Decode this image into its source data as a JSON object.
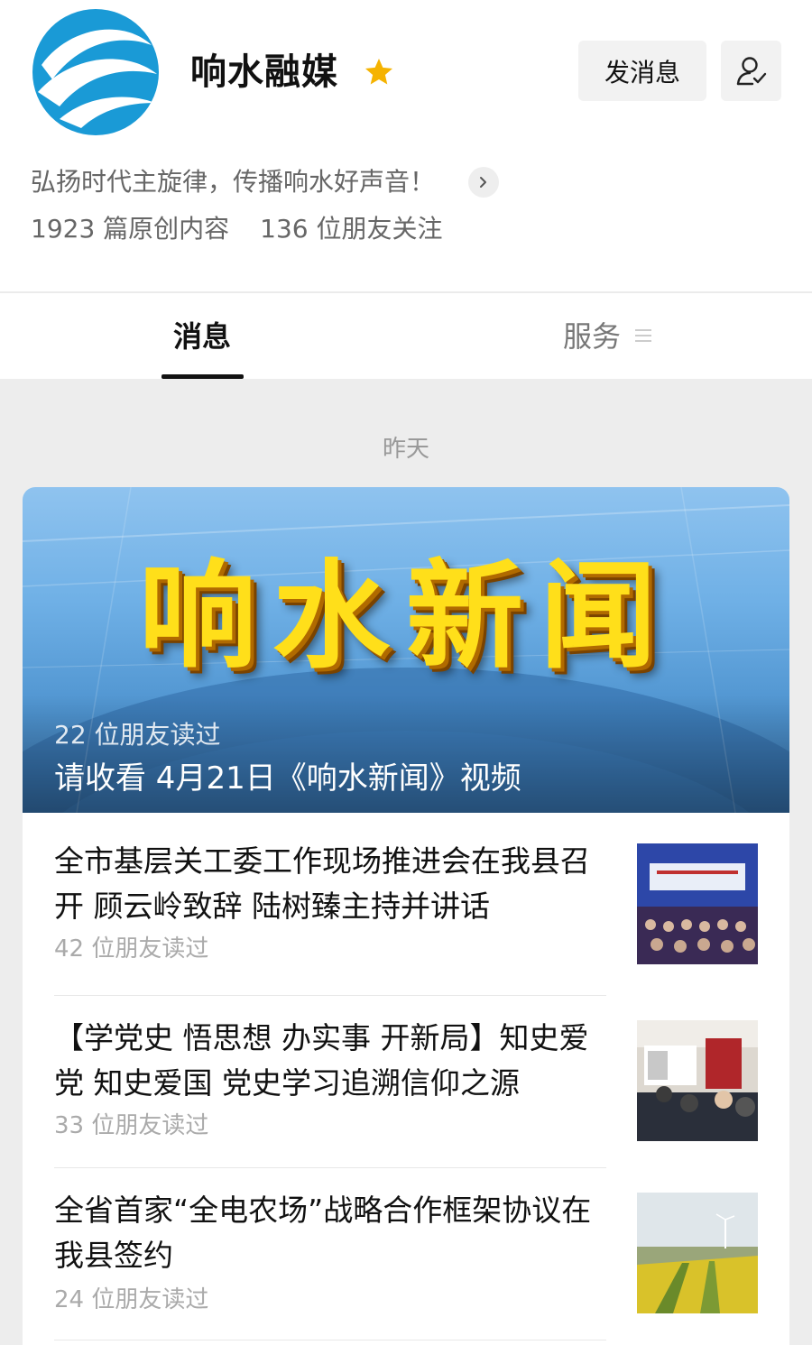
{
  "account": {
    "name": "响水融媒",
    "slogan": "弘扬时代主旋律，传播响水好声音！",
    "original_count": "1923 篇原创内容",
    "followers": "136 位朋友关注"
  },
  "buttons": {
    "send_message": "发消息"
  },
  "tabs": {
    "messages": "消息",
    "services": "服务"
  },
  "feed": {
    "date": "昨天",
    "featured": {
      "cover_title": "响水新闻",
      "reads": "22 位朋友读过",
      "caption": "请收看 4月21日《响水新闻》视频"
    },
    "articles": [
      {
        "title": "全市基层关工委工作现场推进会在我县召开 顾云岭致辞 陆树臻主持并讲话",
        "reads": "42 位朋友读过"
      },
      {
        "title": "【学党史 悟思想 办实事 开新局】知史爱党 知史爱国 党史学习追溯信仰之源",
        "reads": "33 位朋友读过"
      },
      {
        "title": "全省首家“全电农场”战略合作框架协议在我县签约",
        "reads": "24 位朋友读过"
      }
    ]
  },
  "colors": {
    "logo_blue": "#1a9ad6",
    "star": "#f5b301",
    "cover_text": "#ffdf1a"
  },
  "icons": {
    "verified": "star-icon",
    "profile": "user-check-icon",
    "more": "chevron-right-icon",
    "menu": "menu-icon"
  }
}
